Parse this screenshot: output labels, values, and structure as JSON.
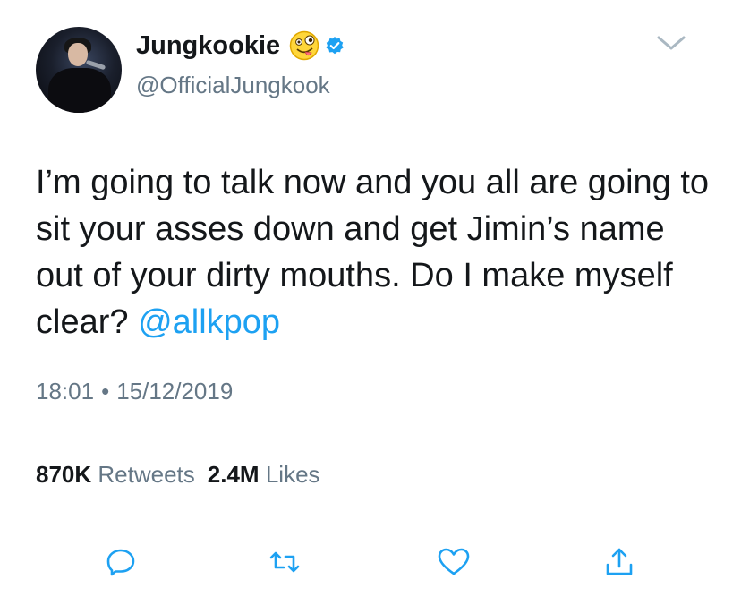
{
  "author": {
    "display_name": "Jungkookie",
    "handle": "@OfficialJungkook",
    "name_emoji": "zany-face-emoji",
    "verified_icon": "verified-badge-icon"
  },
  "tweet": {
    "text": "I’m going to talk now and you all are going to sit your asses down and get Jimin’s name out of your dirty mouths. Do I make myself clear? ",
    "mention": "@allkpop",
    "time": "18:01",
    "separator": "•",
    "date": "15/12/2019"
  },
  "stats": {
    "retweets_count": "870K",
    "retweets_label": "Retweets",
    "likes_count": "2.4M",
    "likes_label": "Likes"
  },
  "actions": [
    "reply-icon",
    "retweet-icon",
    "like-icon",
    "share-icon"
  ],
  "colors": {
    "text": "#14171a",
    "secondary": "#657786",
    "link": "#1da1f2",
    "divider": "#d8dde1"
  }
}
